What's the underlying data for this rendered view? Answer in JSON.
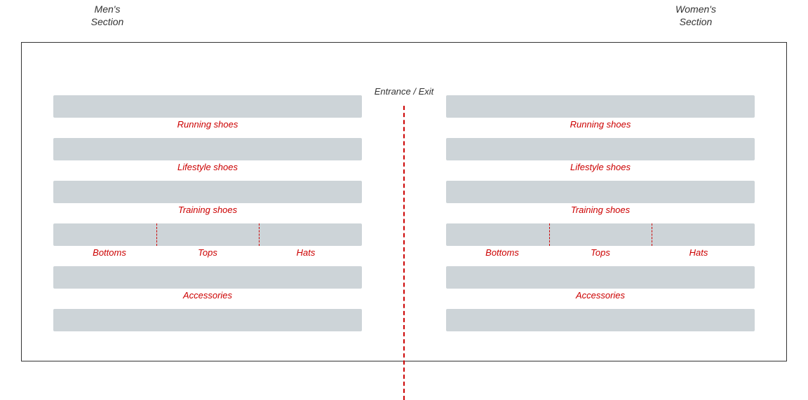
{
  "mens_section": {
    "label_line1": "Men's",
    "label_line2": "Section"
  },
  "womens_section": {
    "label_line1": "Women's",
    "label_line2": "Section"
  },
  "entrance": {
    "label": "Entrance / Exit"
  },
  "shelves": {
    "running": "Running shoes",
    "lifestyle": "Lifestyle shoes",
    "training": "Training shoes",
    "bottoms": "Bottoms",
    "tops": "Tops",
    "hats": "Hats",
    "accessories": "Accessories"
  }
}
